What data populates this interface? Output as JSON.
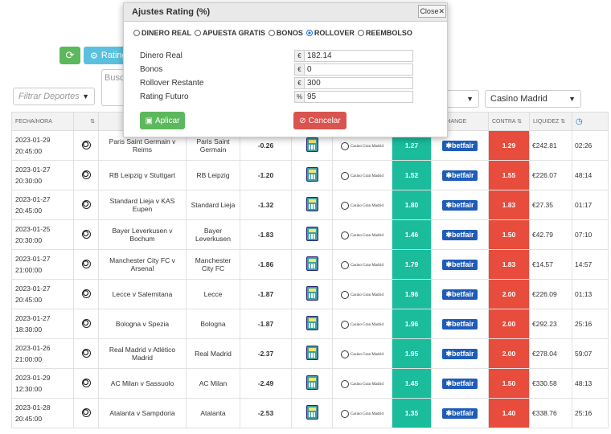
{
  "toolbar": {
    "refresh_icon": "refresh-icon",
    "rating_label": "Rating",
    "search_placeholder": "Busca"
  },
  "filters": {
    "sports_placeholder": "Filtrar Deportes",
    "casino_select": "Casino Madrid"
  },
  "table": {
    "headers": [
      "FECHA/HORA",
      "",
      "",
      "",
      "",
      "",
      "",
      "",
      "EXCHANGE",
      "CONTRA",
      "LIQUIDEZ",
      ""
    ],
    "rows": [
      {
        "date": "2023-01-29",
        "time": "20:45:00",
        "event": "Paris Saint Germain v Reims",
        "selection": "Paris Saint Germain",
        "rating": "-0.26",
        "back": "1.27",
        "lay": "1.29",
        "liquidity": "€242.81",
        "remaining": "02:26"
      },
      {
        "date": "2023-01-27",
        "time": "20:30:00",
        "event": "RB Leipzig v Stuttgart",
        "selection": "RB Leipzig",
        "rating": "-1.20",
        "back": "1.52",
        "lay": "1.55",
        "liquidity": "€226.07",
        "remaining": "48:14"
      },
      {
        "date": "2023-01-27",
        "time": "20:45:00",
        "event": "Standard Lieja v KAS Eupen",
        "selection": "Standard Lieja",
        "rating": "-1.32",
        "back": "1.80",
        "lay": "1.83",
        "liquidity": "€27.35",
        "remaining": "01:17"
      },
      {
        "date": "2023-01-25",
        "time": "20:30:00",
        "event": "Bayer Leverkusen v Bochum",
        "selection": "Bayer Leverkusen",
        "rating": "-1.83",
        "back": "1.46",
        "lay": "1.50",
        "liquidity": "€42.79",
        "remaining": "07:10"
      },
      {
        "date": "2023-01-27",
        "time": "21:00:00",
        "event": "Manchester City FC v Arsenal",
        "selection": "Manchester City FC",
        "rating": "-1.86",
        "back": "1.79",
        "lay": "1.83",
        "liquidity": "€14.57",
        "remaining": "14:57"
      },
      {
        "date": "2023-01-27",
        "time": "20:45:00",
        "event": "Lecce v Salernitana",
        "selection": "Lecce",
        "rating": "-1.87",
        "back": "1.96",
        "lay": "2.00",
        "liquidity": "€226.09",
        "remaining": "01:13"
      },
      {
        "date": "2023-01-27",
        "time": "18:30:00",
        "event": "Bologna v Spezia",
        "selection": "Bologna",
        "rating": "-1.87",
        "back": "1.96",
        "lay": "2.00",
        "liquidity": "€292.23",
        "remaining": "25:16"
      },
      {
        "date": "2023-01-26",
        "time": "21:00:00",
        "event": "Real Madrid v Atlético Madrid",
        "selection": "Real Madrid",
        "rating": "-2.37",
        "back": "1.95",
        "lay": "2.00",
        "liquidity": "€278.04",
        "remaining": "59:07"
      },
      {
        "date": "2023-01-29",
        "time": "12:30:00",
        "event": "AC Milan v Sassuolo",
        "selection": "AC Milan",
        "rating": "-2.49",
        "back": "1.45",
        "lay": "1.50",
        "liquidity": "€330.58",
        "remaining": "48:13"
      },
      {
        "date": "2023-01-28",
        "time": "20:45:00",
        "event": "Atalanta v Sampdoria",
        "selection": "Atalanta",
        "rating": "-2.53",
        "back": "1.35",
        "lay": "1.40",
        "liquidity": "€338.76",
        "remaining": "25:16"
      }
    ],
    "bookmaker_text": "Casino Gran Madrid",
    "exchange_text": "betfair"
  },
  "modal": {
    "title": "Ajustes Rating (%)",
    "close_label": "Close",
    "radios": [
      {
        "label": "DINERO REAL",
        "checked": false
      },
      {
        "label": "APUESTA GRATIS",
        "checked": false
      },
      {
        "label": "BONOS",
        "checked": false
      },
      {
        "label": "ROLLOVER",
        "checked": true
      },
      {
        "label": "REEMBOLSO",
        "checked": false
      }
    ],
    "fields": [
      {
        "label": "Dinero Real",
        "addon": "€",
        "value": "182.14"
      },
      {
        "label": "Bonos",
        "addon": "€",
        "value": "0"
      },
      {
        "label": "Rollover Restante",
        "addon": "€",
        "value": "300"
      },
      {
        "label": "Rating Futuro",
        "addon": "%",
        "value": "95"
      }
    ],
    "apply_label": "Aplicar",
    "cancel_label": "Cancelar"
  },
  "colors": {
    "back": "#1abc9c",
    "lay": "#e74c3c",
    "apply": "#5cb85c",
    "cancel": "#d9534f",
    "betfair": "#1f5cb8"
  }
}
